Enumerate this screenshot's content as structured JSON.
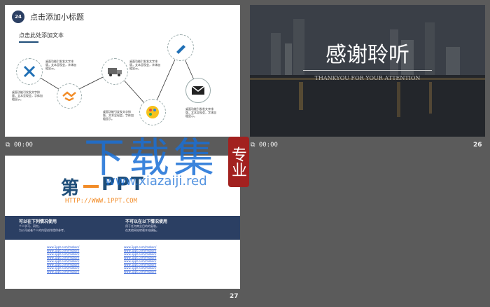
{
  "slide25": {
    "badge": "24",
    "title": "点击添加小标题",
    "subtitle": "点击此处添加文本",
    "blurb": "桌面功能引发发文字排版，文本呈现会，字体加粗显示。"
  },
  "slide26": {
    "title": "感谢聆听",
    "subtitle": "THANKYOU FOR YOUR ATTENTION"
  },
  "slide27": {
    "logo_left": "第",
    "logo_right": "PPT",
    "url": "HTTP://WWW.1PPT.COM",
    "banner_left_title": "可以在下列情况使用",
    "banner_left_lines": [
      "个人学习、研究。",
      "为公司或者个人的内容创作提供参考。"
    ],
    "banner_right_title": "不可以在以下情况使用",
    "banner_right_lines": [
      "用于任何商业目的的复制。",
      "在其他网站转载本站模板。"
    ],
    "link_text": "www.1ppt.com/moban/"
  },
  "labels": {
    "time_left": "00:00",
    "time_right": "00:00",
    "num_26": "26",
    "num_27": "27"
  },
  "watermark": {
    "big": "下载集",
    "small_url": "www.xiazaiji.red",
    "seal": "专业"
  },
  "colors": {
    "accent_blue": "#1f4e79",
    "navy": "#2b3f63",
    "seal_red": "#a2211f",
    "watermark_blue": "#1a6fd6"
  }
}
